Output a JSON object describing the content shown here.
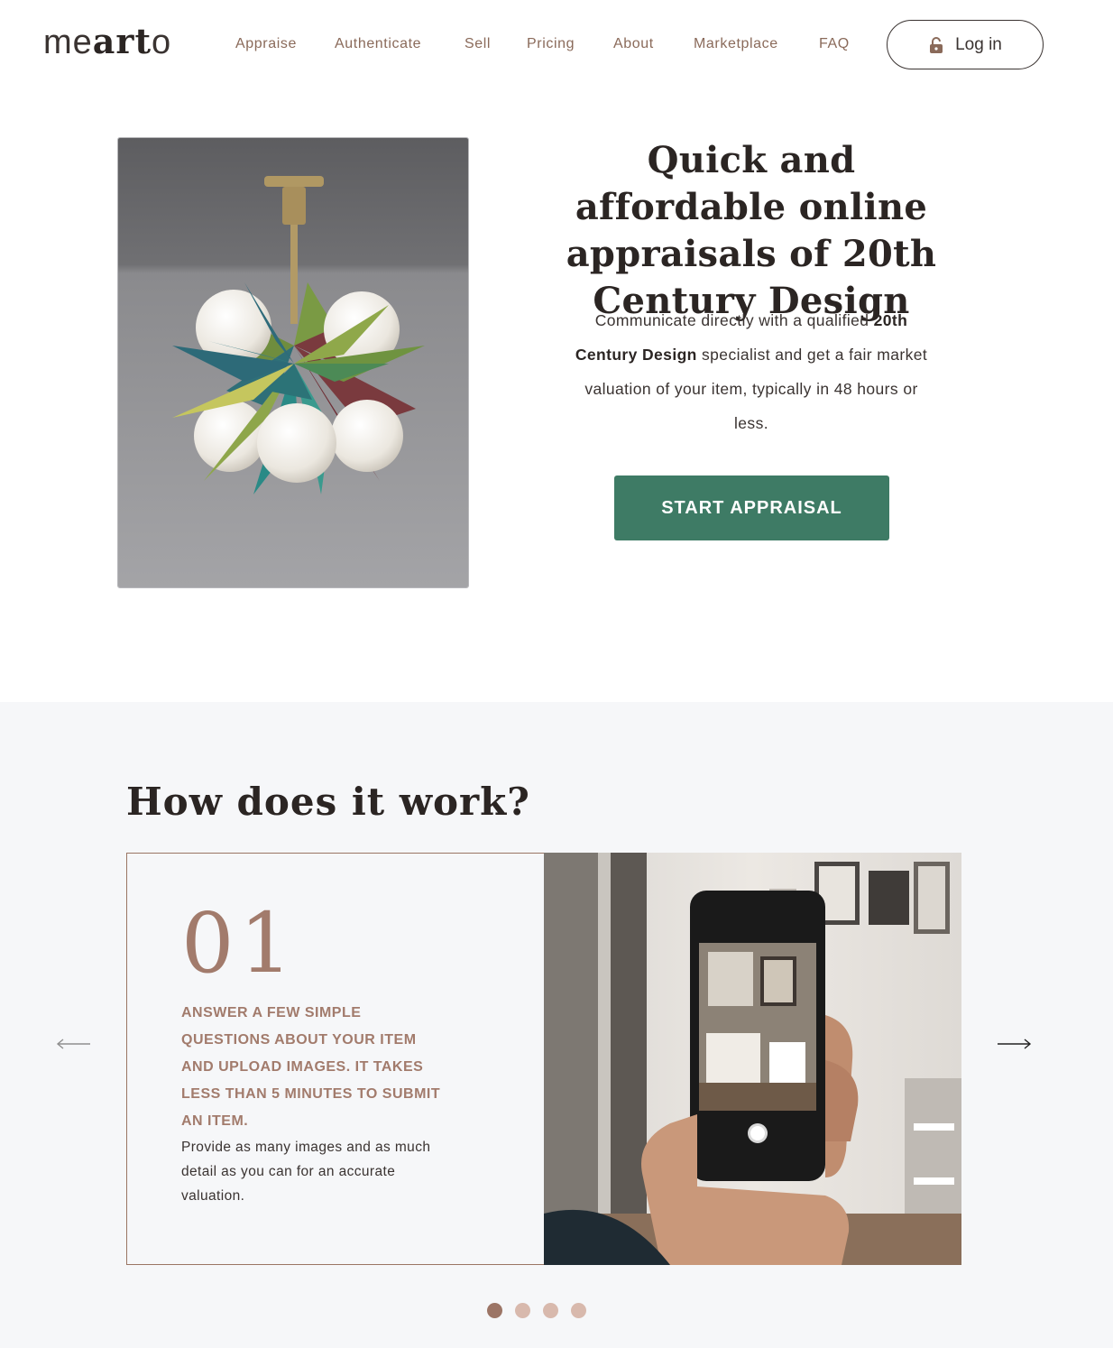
{
  "header": {
    "logo_text_thin": "me",
    "logo_text_bold": "art",
    "logo_text_end": "o",
    "nav": [
      {
        "label": "Appraise"
      },
      {
        "label": "Authenticate"
      },
      {
        "label": "Sell"
      },
      {
        "label": "Pricing"
      },
      {
        "label": "About"
      },
      {
        "label": "Marketplace"
      },
      {
        "label": "FAQ"
      }
    ],
    "login_label": "Log in",
    "login_icon": "lock-icon"
  },
  "hero": {
    "image_subject": "pendant-lamp-photo",
    "title": "Quick and affordable online appraisals of 20th Century Design",
    "desc_part1": "Communicate directly with a qualified ",
    "desc_bold": "20th Century Design",
    "desc_part2": " specialist and get a fair market valuation of your item, typically in 48 hours or less.",
    "cta_label": "START APPRAISAL"
  },
  "how": {
    "title": "How does it work?",
    "step": {
      "number": "01",
      "heading": "ANSWER A FEW SIMPLE QUESTIONS ABOUT YOUR ITEM AND UPLOAD IMAGES. IT TAKES LESS THAN 5 MINUTES TO SUBMIT AN ITEM.",
      "body": "Provide as many images and as much detail as you can for an accurate valuation.",
      "image_subject": "phone-camera-photo"
    },
    "prev_icon": "arrow-left-icon",
    "next_icon": "arrow-right-icon",
    "dots_total": 4,
    "dots_active": 1
  },
  "colors": {
    "accent_green": "#3e7b65",
    "nav_brown": "#8a6a5a",
    "step_brown": "#a27b6c",
    "dot_active": "#9c7566",
    "dot_inactive": "#d8b9ad",
    "section_bg": "#f6f7f9"
  }
}
